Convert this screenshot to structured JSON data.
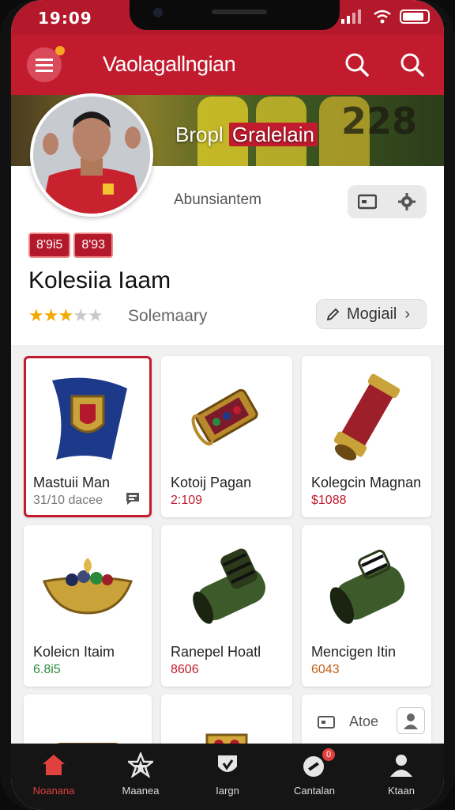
{
  "status": {
    "time": "19:09"
  },
  "appbar": {
    "title": "Vaolagallngian"
  },
  "hero": {
    "title_part1": "Bropl ",
    "title_part2": "Gralelain",
    "jersey_number": "228"
  },
  "profile": {
    "subtitle": "Abunsiantem",
    "badges": [
      "8'9i5",
      "8'93"
    ],
    "name": "Kolesiia Iaam",
    "rating": 3,
    "rating_max": 5,
    "summary": "Solemaary",
    "edit_label": "Mogiail"
  },
  "items": [
    {
      "title": "Mastuii Man",
      "price": "31/10 dacee",
      "icon": "emblem-cape",
      "accent": "#1d3a8a"
    },
    {
      "title": "Kotoij Pagan",
      "price": "2:109",
      "icon": "ornate-device",
      "accent": "#b98a2c"
    },
    {
      "title": "Kolegcin Magnan",
      "price": "$1088",
      "icon": "capsule",
      "accent": "#9c1f2a"
    },
    {
      "title": "Koleicn Itaim",
      "price": "6.8i5",
      "icon": "gem-bowl",
      "accent": "#c9a23a"
    },
    {
      "title": "Ranepel Hoatl",
      "price": "8606",
      "icon": "boot",
      "accent": "#3d5a2a"
    },
    {
      "title": "Mencigen Itin",
      "price": "6043",
      "icon": "cannon",
      "accent": "#3d5a2a"
    },
    {
      "title": "",
      "price": "",
      "icon": "bag",
      "accent": "#9a6a35"
    },
    {
      "title": "",
      "price": "",
      "icon": "gold-shield",
      "accent": "#d4a93a"
    },
    {
      "title": "Atoe",
      "price": "",
      "icon": "add-card",
      "accent": "#888888"
    }
  ],
  "nav": [
    {
      "label": "Noanana",
      "icon": "home-icon",
      "active": true
    },
    {
      "label": "Maanea",
      "icon": "star-icon",
      "active": false
    },
    {
      "label": "Iargn",
      "icon": "shield-icon",
      "active": false
    },
    {
      "label": "Cantalan",
      "icon": "chat-icon",
      "active": false,
      "badge": "0"
    },
    {
      "label": "Ktaan",
      "icon": "profile-icon",
      "active": false
    }
  ],
  "colors": {
    "brand": "#c21b2e",
    "star": "#f2a900",
    "nav_bg": "#151515"
  }
}
